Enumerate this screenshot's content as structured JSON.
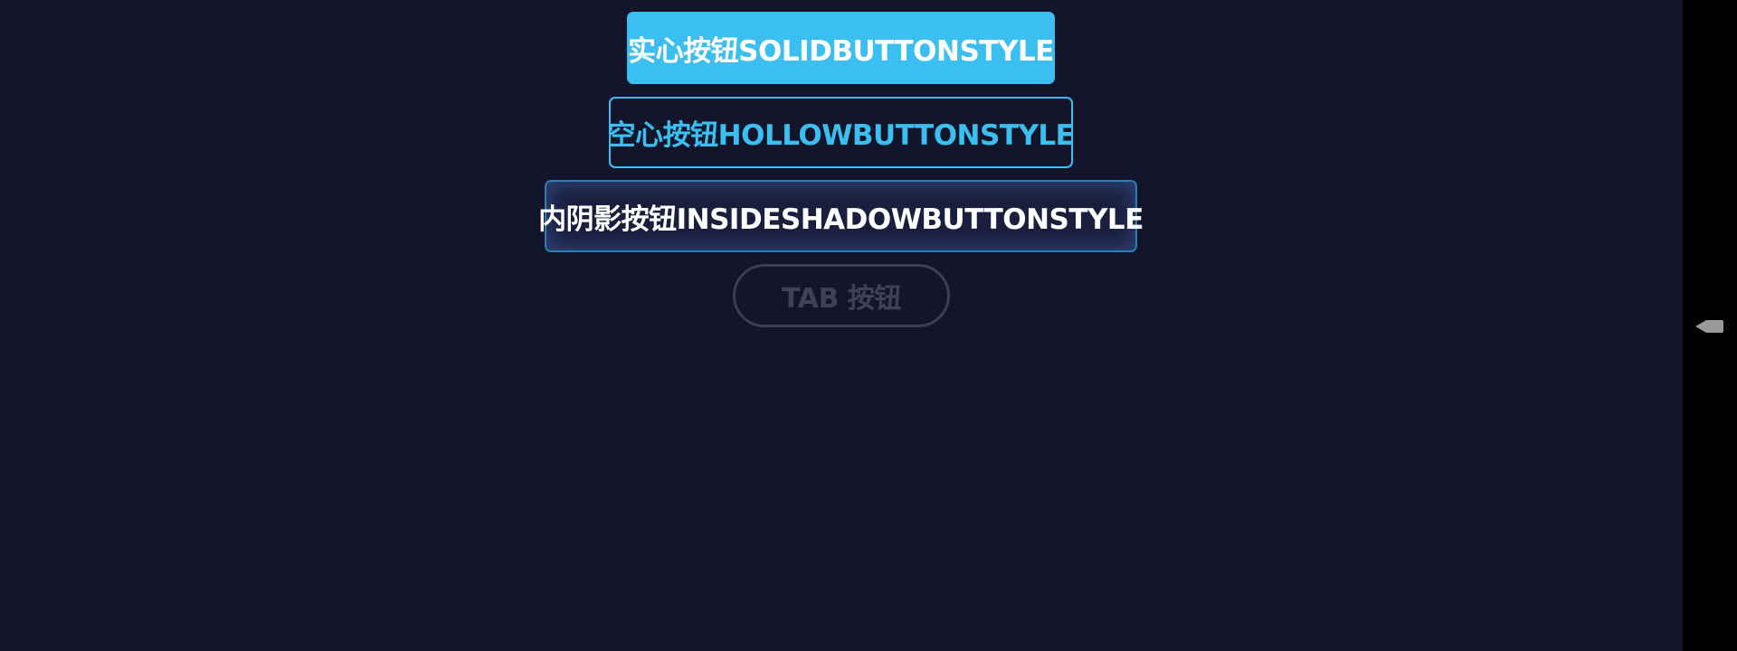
{
  "buttons": {
    "solid_label": "实心按钮SOLIDBUTTONSTYLE",
    "hollow_label": "空心按钮HOLLOWBUTTONSTYLE",
    "inset_label": "内阴影按钮INSIDESHADOWBUTTONSTYLE",
    "tab_label": "TAB 按钮"
  },
  "colors": {
    "background": "#13162b",
    "accent": "#3bbff0",
    "inset_border": "#2b7fb3",
    "disabled_text": "#3e4259"
  },
  "side_handle": {
    "icon": "back-arrow-icon"
  }
}
